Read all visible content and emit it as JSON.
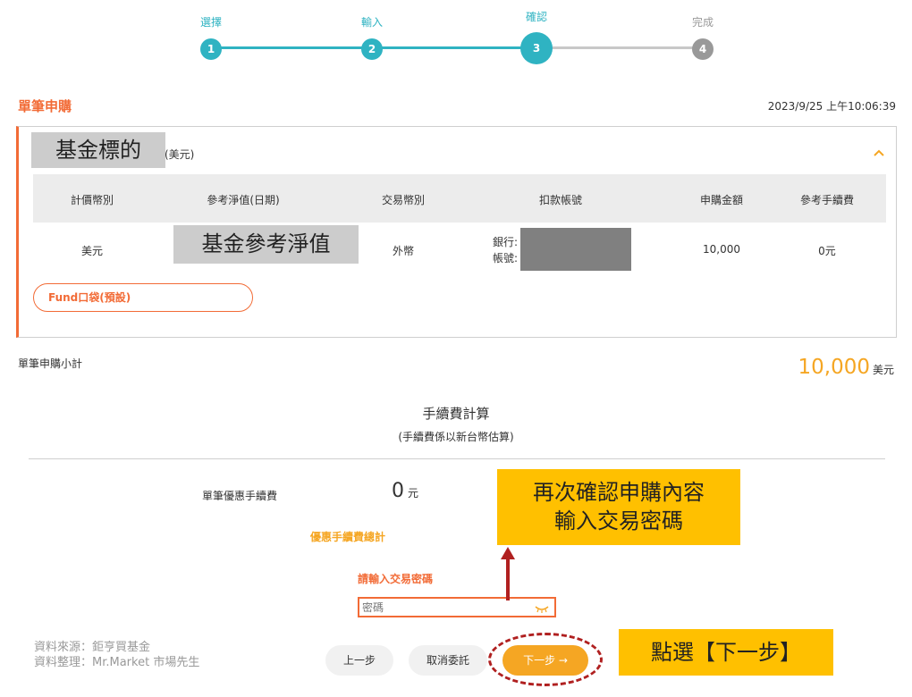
{
  "stepper": {
    "steps": [
      {
        "label": "選擇",
        "number": "1"
      },
      {
        "label": "輸入",
        "number": "2"
      },
      {
        "label": "確認",
        "number": "3"
      },
      {
        "label": "完成",
        "number": "4"
      }
    ],
    "current_step": 3
  },
  "section": {
    "title": "單筆申購",
    "timestamp": "2023/9/25 上午10:06:39"
  },
  "fund": {
    "name_label": "基金標的",
    "currency_suffix": "(美元)",
    "table": {
      "headers": [
        "計價幣別",
        "參考淨值(日期)",
        "交易幣別",
        "扣款帳號",
        "申購金額",
        "參考手續費"
      ],
      "row": {
        "currency": "美元",
        "nav_label": "基金參考淨值",
        "trade_currency": "外幣",
        "bank_label": "銀行:",
        "account_label": "帳號:",
        "amount": "10,000",
        "fee": "0元"
      }
    },
    "pocket_button": "Fund口袋(預設)"
  },
  "subtotal": {
    "label": "單筆申購小計",
    "value": "10,000",
    "unit": "美元"
  },
  "fee_calc": {
    "title": "手續費計算",
    "subtitle": "(手續費係以新台幣估算)",
    "discount_label": "單筆優惠手續費",
    "discount_value": "0",
    "discount_unit": "元",
    "total_label": "優惠手續費總計"
  },
  "password": {
    "label": "請輸入交易密碼",
    "placeholder": "密碼"
  },
  "buttons": {
    "prev": "上一步",
    "cancel": "取消委託",
    "next": "下一步 →"
  },
  "source": {
    "line1": "資料來源：鉅亨買基金",
    "line2": "資料整理：Mr.Market 市場先生"
  },
  "callouts": {
    "confirm_line1": "再次確認申購內容",
    "confirm_line2": "輸入交易密碼",
    "next": "點選【下一步】"
  },
  "colors": {
    "teal": "#2fb3c2",
    "orange": "#f26b36",
    "amber": "#f5a623",
    "callout": "#ffc000",
    "marker_red": "#b02020"
  }
}
